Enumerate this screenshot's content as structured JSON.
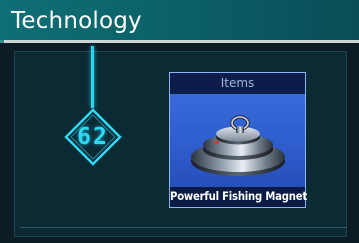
{
  "header": {
    "title": "Technology"
  },
  "level": {
    "value": "62"
  },
  "item": {
    "category": "Items",
    "name": "Powerful Fishing Magnet",
    "icon": "fishing-magnet-icon"
  },
  "colors": {
    "title_bar": "#0e6f76",
    "accent_cyan": "#29d4ee",
    "card_blue": "#3f6fe0",
    "card_header": "#0c1d4c"
  }
}
